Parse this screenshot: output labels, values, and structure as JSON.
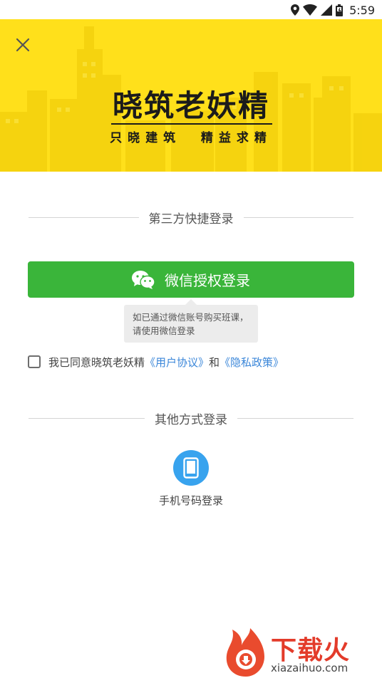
{
  "status_bar": {
    "time": "5:59",
    "icons": [
      "location-icon",
      "wifi-icon",
      "signal-icon",
      "battery-icon"
    ]
  },
  "banner": {
    "logo_title": "晓筑老妖精",
    "logo_slogan": "只晓建筑  精益求精",
    "background_color": "#ffe01b"
  },
  "quick_login": {
    "divider_text": "第三方快捷登录",
    "wechat_button_label": "微信授权登录",
    "wechat_icon": "wechat-icon",
    "tooltip_text": "如已通过微信账号购买班课，请使用微信登录",
    "button_color": "#3ab53a"
  },
  "agreement": {
    "checked": false,
    "prefix": "我已同意晓筑老妖精",
    "user_agreement_link": "《用户协议》",
    "connector": "和",
    "privacy_policy_link": "《隐私政策》",
    "link_color": "#3a86d9"
  },
  "other_login": {
    "divider_text": "其他方式登录",
    "phone_login_label": "手机号码登录",
    "phone_icon": "phone-icon",
    "icon_color": "#38a3ee"
  },
  "watermark": {
    "brand": "下载火",
    "url": "xiazaihuo.com"
  }
}
